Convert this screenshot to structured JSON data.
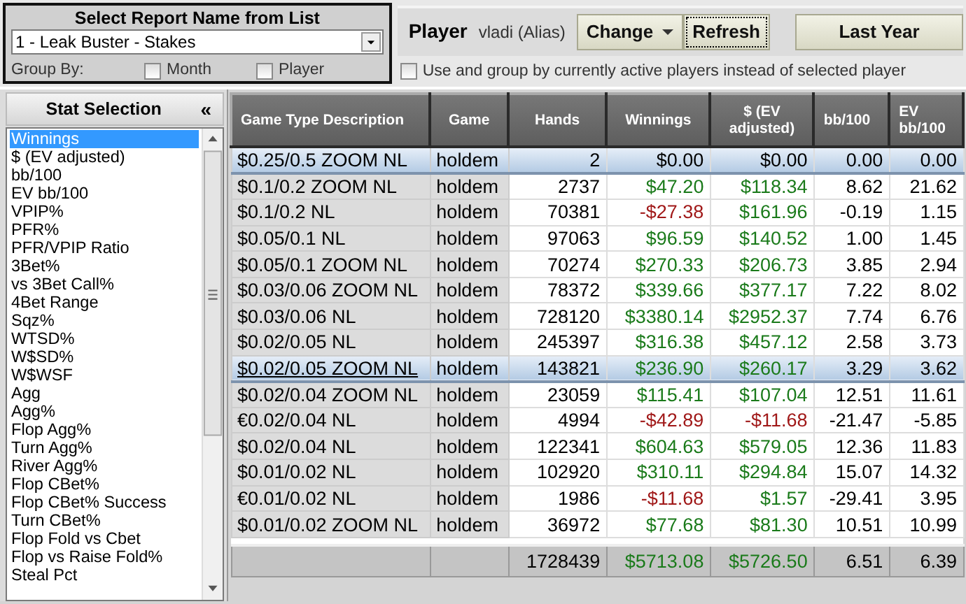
{
  "report": {
    "title": "Select Report Name from List",
    "selected_report": "1 - Leak Buster - Stakes",
    "group_by_label": "Group By:",
    "group_by": [
      {
        "label": "Month",
        "checked": false
      },
      {
        "label": "Player",
        "checked": false
      }
    ]
  },
  "player": {
    "label": "Player",
    "name": "vladi (Alias)",
    "buttons": [
      {
        "label": "Change",
        "kind": "dropdown",
        "focused": false
      },
      {
        "label": "Refresh",
        "kind": "plain",
        "focused": true
      }
    ],
    "period_button": "Last Year"
  },
  "active_players_option": {
    "label": "Use and group by currently active players instead of selected player",
    "checked": false
  },
  "stat_selection": {
    "title": "Stat Selection",
    "collapse_glyph": "«",
    "items": [
      {
        "label": "Winnings",
        "selected": true
      },
      {
        "label": "$ (EV adjusted)",
        "selected": false
      },
      {
        "label": "bb/100",
        "selected": false
      },
      {
        "label": "EV bb/100",
        "selected": false
      },
      {
        "label": "VPIP%",
        "selected": false
      },
      {
        "label": "PFR%",
        "selected": false
      },
      {
        "label": "PFR/VPIP Ratio",
        "selected": false
      },
      {
        "label": "3Bet%",
        "selected": false
      },
      {
        "label": "vs 3Bet Call%",
        "selected": false
      },
      {
        "label": "4Bet Range",
        "selected": false
      },
      {
        "label": "Sqz%",
        "selected": false
      },
      {
        "label": "WTSD%",
        "selected": false
      },
      {
        "label": "W$SD%",
        "selected": false
      },
      {
        "label": "W$WSF",
        "selected": false
      },
      {
        "label": "Agg",
        "selected": false
      },
      {
        "label": "Agg%",
        "selected": false
      },
      {
        "label": "Flop Agg%",
        "selected": false
      },
      {
        "label": "Turn Agg%",
        "selected": false
      },
      {
        "label": "River Agg%",
        "selected": false
      },
      {
        "label": "Flop CBet%",
        "selected": false
      },
      {
        "label": "Flop CBet% Success",
        "selected": false
      },
      {
        "label": "Turn CBet%",
        "selected": false
      },
      {
        "label": "Flop Fold vs Cbet",
        "selected": false
      },
      {
        "label": "Flop vs Raise Fold%",
        "selected": false
      },
      {
        "label": "Steal Pct",
        "selected": false
      }
    ]
  },
  "table": {
    "columns": [
      "Game Type Description",
      "Game",
      "Hands",
      "Winnings",
      "$ (EV adjusted)",
      "bb/100",
      "EV bb/100"
    ],
    "rows": [
      {
        "description": "$0.25/0.5 ZOOM NL",
        "game": "holdem",
        "hands": "2",
        "winnings": {
          "text": "$0.00",
          "color": "#000000"
        },
        "ev_adjusted": {
          "text": "$0.00",
          "color": "#000000"
        },
        "bb100": "0.00",
        "ev_bb100": "0.00",
        "selected": true,
        "hovered": false
      },
      {
        "description": "$0.1/0.2 ZOOM NL",
        "game": "holdem",
        "hands": "2737",
        "winnings": {
          "text": "$47.20",
          "color": "#1a7a1a"
        },
        "ev_adjusted": {
          "text": "$118.34",
          "color": "#1a7a1a"
        },
        "bb100": "8.62",
        "ev_bb100": "21.62",
        "selected": false,
        "hovered": false
      },
      {
        "description": "$0.1/0.2 NL",
        "game": "holdem",
        "hands": "70381",
        "winnings": {
          "text": "-$27.38",
          "color": "#a01818"
        },
        "ev_adjusted": {
          "text": "$161.96",
          "color": "#1a7a1a"
        },
        "bb100": "-0.19",
        "ev_bb100": "1.15",
        "selected": false,
        "hovered": false
      },
      {
        "description": "$0.05/0.1 NL",
        "game": "holdem",
        "hands": "97063",
        "winnings": {
          "text": "$96.59",
          "color": "#1a7a1a"
        },
        "ev_adjusted": {
          "text": "$140.52",
          "color": "#1a7a1a"
        },
        "bb100": "1.00",
        "ev_bb100": "1.45",
        "selected": false,
        "hovered": false
      },
      {
        "description": "$0.05/0.1 ZOOM NL",
        "game": "holdem",
        "hands": "70274",
        "winnings": {
          "text": "$270.33",
          "color": "#1a7a1a"
        },
        "ev_adjusted": {
          "text": "$206.73",
          "color": "#1a7a1a"
        },
        "bb100": "3.85",
        "ev_bb100": "2.94",
        "selected": false,
        "hovered": false
      },
      {
        "description": "$0.03/0.06 ZOOM NL",
        "game": "holdem",
        "hands": "78372",
        "winnings": {
          "text": "$339.66",
          "color": "#1a7a1a"
        },
        "ev_adjusted": {
          "text": "$377.17",
          "color": "#1a7a1a"
        },
        "bb100": "7.22",
        "ev_bb100": "8.02",
        "selected": false,
        "hovered": false
      },
      {
        "description": "$0.03/0.06 NL",
        "game": "holdem",
        "hands": "728120",
        "winnings": {
          "text": "$3380.14",
          "color": "#1a7a1a"
        },
        "ev_adjusted": {
          "text": "$2952.37",
          "color": "#1a7a1a"
        },
        "bb100": "7.74",
        "ev_bb100": "6.76",
        "selected": false,
        "hovered": false
      },
      {
        "description": "$0.02/0.05 NL",
        "game": "holdem",
        "hands": "245397",
        "winnings": {
          "text": "$316.38",
          "color": "#1a7a1a"
        },
        "ev_adjusted": {
          "text": "$457.12",
          "color": "#1a7a1a"
        },
        "bb100": "2.58",
        "ev_bb100": "3.73",
        "selected": false,
        "hovered": false
      },
      {
        "description": "$0.02/0.05 ZOOM NL",
        "game": "holdem",
        "hands": "143821",
        "winnings": {
          "text": "$236.90",
          "color": "#1a7a1a"
        },
        "ev_adjusted": {
          "text": "$260.17",
          "color": "#1a7a1a"
        },
        "bb100": "3.29",
        "ev_bb100": "3.62",
        "selected": true,
        "hovered": true
      },
      {
        "description": "$0.02/0.04 ZOOM NL",
        "game": "holdem",
        "hands": "23059",
        "winnings": {
          "text": "$115.41",
          "color": "#1a7a1a"
        },
        "ev_adjusted": {
          "text": "$107.04",
          "color": "#1a7a1a"
        },
        "bb100": "12.51",
        "ev_bb100": "11.61",
        "selected": false,
        "hovered": false
      },
      {
        "description": "€0.02/0.04 NL",
        "game": "holdem",
        "hands": "4994",
        "winnings": {
          "text": "-$42.89",
          "color": "#a01818"
        },
        "ev_adjusted": {
          "text": "-$11.68",
          "color": "#a01818"
        },
        "bb100": "-21.47",
        "ev_bb100": "-5.85",
        "selected": false,
        "hovered": false
      },
      {
        "description": "$0.02/0.04 NL",
        "game": "holdem",
        "hands": "122341",
        "winnings": {
          "text": "$604.63",
          "color": "#1a7a1a"
        },
        "ev_adjusted": {
          "text": "$579.05",
          "color": "#1a7a1a"
        },
        "bb100": "12.36",
        "ev_bb100": "11.83",
        "selected": false,
        "hovered": false
      },
      {
        "description": "$0.01/0.02 NL",
        "game": "holdem",
        "hands": "102920",
        "winnings": {
          "text": "$310.11",
          "color": "#1a7a1a"
        },
        "ev_adjusted": {
          "text": "$294.84",
          "color": "#1a7a1a"
        },
        "bb100": "15.07",
        "ev_bb100": "14.32",
        "selected": false,
        "hovered": false
      },
      {
        "description": "€0.01/0.02 NL",
        "game": "holdem",
        "hands": "1986",
        "winnings": {
          "text": "-$11.68",
          "color": "#a01818"
        },
        "ev_adjusted": {
          "text": "$1.57",
          "color": "#1a7a1a"
        },
        "bb100": "-29.41",
        "ev_bb100": "3.95",
        "selected": false,
        "hovered": false
      },
      {
        "description": "$0.01/0.02 ZOOM NL",
        "game": "holdem",
        "hands": "36972",
        "winnings": {
          "text": "$77.68",
          "color": "#1a7a1a"
        },
        "ev_adjusted": {
          "text": "$81.30",
          "color": "#1a7a1a"
        },
        "bb100": "10.51",
        "ev_bb100": "10.99",
        "selected": false,
        "hovered": false
      }
    ],
    "totals": {
      "hands": "1728439",
      "winnings": {
        "text": "$5713.08",
        "color": "#1a7a1a"
      },
      "ev_adjusted": {
        "text": "$5726.50",
        "color": "#1a7a1a"
      },
      "bb100": "6.51",
      "ev_bb100": "6.39"
    }
  }
}
